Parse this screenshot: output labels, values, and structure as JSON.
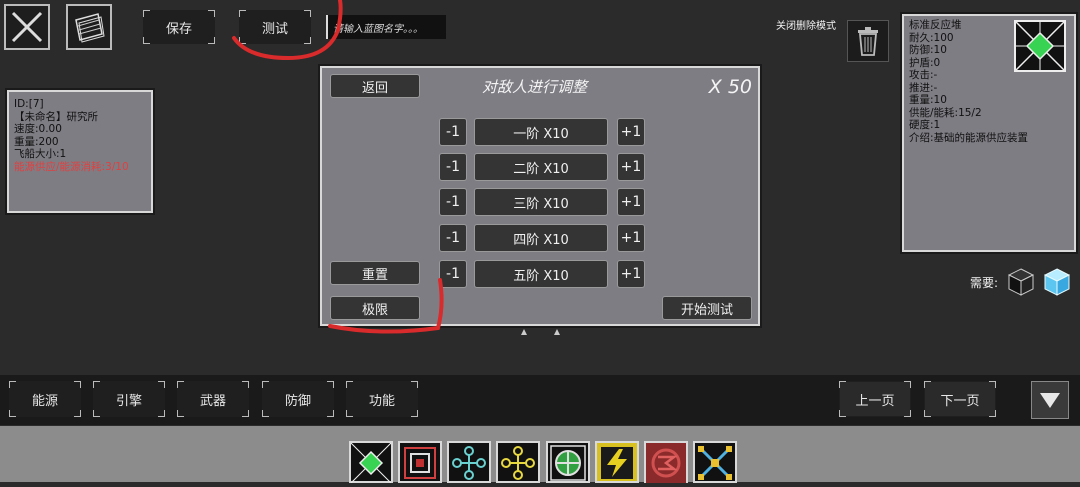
{
  "toolbar": {
    "save_label": "保存",
    "test_label": "测试",
    "name_placeholder": "请输入蓝图名字。。。",
    "delete_mode_label": "关闭删除模式"
  },
  "ship_info": {
    "lines": [
      "ID:[7]",
      "【未命名】研究所",
      "速度:0.00",
      "重量:200",
      "飞船大小:1"
    ],
    "warning": "能源供应/能源消耗:3/10",
    "warning_color": "#e04040"
  },
  "dialog": {
    "title": "对敌人进行调整",
    "multiplier": "X 50",
    "back_label": "返回",
    "reset_label": "重置",
    "limit_label": "极限",
    "start_label": "开始测试",
    "tiers": [
      {
        "minus": "-1",
        "label": "一阶 X10",
        "plus": "+1"
      },
      {
        "minus": "-1",
        "label": "二阶 X10",
        "plus": "+1"
      },
      {
        "minus": "-1",
        "label": "三阶 X10",
        "plus": "+1"
      },
      {
        "minus": "-1",
        "label": "四阶 X10",
        "plus": "+1"
      },
      {
        "minus": "-1",
        "label": "五阶 X10",
        "plus": "+1"
      }
    ]
  },
  "component_info": {
    "lines": [
      "标准反应堆",
      "耐久:100",
      "防御:10",
      "护盾:0",
      "攻击:-",
      "推进:-",
      "重量:10",
      "供能/能耗:15/2",
      "硬度:1",
      "介绍:基础的能源供应装置"
    ],
    "needs_label": "需要:"
  },
  "categories": [
    "能源",
    "引擎",
    "武器",
    "防御",
    "功能"
  ],
  "pagination": {
    "prev_label": "上一页",
    "next_label": "下一页"
  },
  "colors": {
    "accent_green": "#39d353",
    "annotation_red": "#d92b2b",
    "panel": "#7f7d84"
  }
}
